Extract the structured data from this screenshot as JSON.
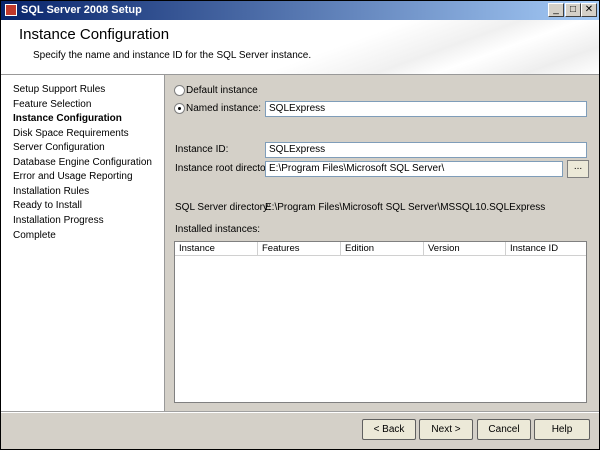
{
  "window": {
    "title": "SQL Server 2008 Setup"
  },
  "titlebar_buttons": {
    "minimize": "_",
    "maximize": "□",
    "close": "✕"
  },
  "banner": {
    "title": "Instance Configuration",
    "subtitle": "Specify the name and instance ID for the SQL Server instance."
  },
  "sidebar": {
    "items": [
      {
        "label": "Setup Support Rules"
      },
      {
        "label": "Feature Selection"
      },
      {
        "label": "Instance Configuration"
      },
      {
        "label": "Disk Space Requirements"
      },
      {
        "label": "Server Configuration"
      },
      {
        "label": "Database Engine Configuration"
      },
      {
        "label": "Error and Usage Reporting"
      },
      {
        "label": "Installation Rules"
      },
      {
        "label": "Ready to Install"
      },
      {
        "label": "Installation Progress"
      },
      {
        "label": "Complete"
      }
    ],
    "active_index": 2
  },
  "form": {
    "default_instance_label": "Default instance",
    "named_instance_label": "Named instance:",
    "named_instance_value": "SQLExpress",
    "instance_id_label": "Instance ID:",
    "instance_id_value": "SQLExpress",
    "instance_root_label": "Instance root directory:",
    "instance_root_value": "E:\\Program Files\\Microsoft SQL Server\\",
    "browse_label": "...",
    "server_dir_label": "SQL Server directory:",
    "server_dir_value": "E:\\Program Files\\Microsoft SQL Server\\MSSQL10.SQLExpress",
    "installed_label": "Installed instances:",
    "selected": "named"
  },
  "installed_table": {
    "columns": [
      "Instance",
      "Features",
      "Edition",
      "Version",
      "Instance ID"
    ],
    "rows": []
  },
  "buttons": {
    "back": "< Back",
    "next": "Next >",
    "cancel": "Cancel",
    "help": "Help"
  }
}
